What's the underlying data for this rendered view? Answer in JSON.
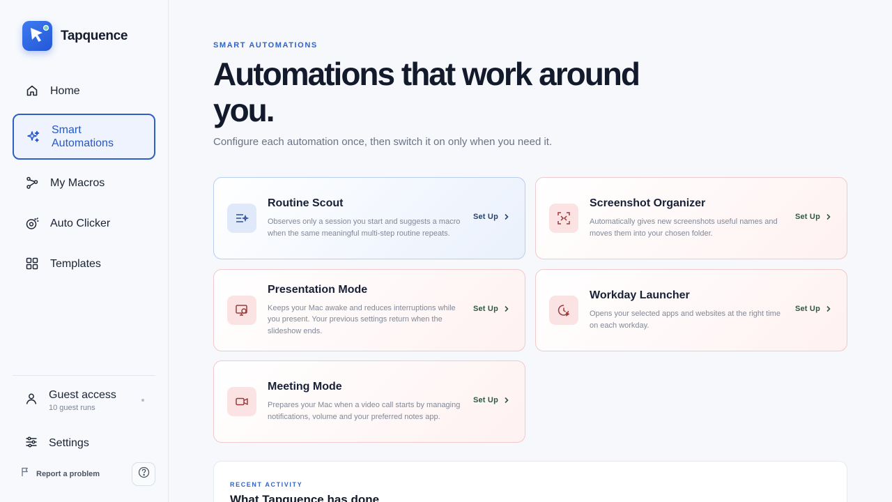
{
  "app": {
    "name": "Tapquence"
  },
  "sidebar": {
    "items": [
      {
        "label": "Home",
        "icon": "home-icon"
      },
      {
        "label": "Smart Automations",
        "icon": "sparkles-icon",
        "active": true
      },
      {
        "label": "My Macros",
        "icon": "macro-path-icon"
      },
      {
        "label": "Auto Clicker",
        "icon": "target-click-icon"
      },
      {
        "label": "Templates",
        "icon": "grid-icon"
      }
    ],
    "guest": {
      "title": "Guest access",
      "subtitle": "10 guest runs"
    },
    "settings_label": "Settings",
    "report_label": "Report a problem"
  },
  "header": {
    "eyebrow": "SMART AUTOMATIONS",
    "title": "Automations that work around you.",
    "subtitle": "Configure each automation once, then switch it on only when you need it."
  },
  "cards": [
    {
      "title": "Routine Scout",
      "description": "Observes only a session you start and suggests a macro when the same meaningful multi-step routine repeats.",
      "action": "Set Up",
      "icon": "routine-scan-icon"
    },
    {
      "title": "Screenshot Organizer",
      "description": "Automatically gives new screenshots useful names and moves them into your chosen folder.",
      "action": "Set Up",
      "icon": "screenshot-frame-icon"
    },
    {
      "title": "Presentation Mode",
      "description": "Keeps your Mac awake and reduces interruptions while you present. Your previous settings return when the slideshow ends.",
      "action": "Set Up",
      "icon": "presentation-monitor-icon"
    },
    {
      "title": "Workday Launcher",
      "description": "Opens your selected apps and websites at the right time on each workday.",
      "action": "Set Up",
      "icon": "clock-launch-icon"
    },
    {
      "title": "Meeting Mode",
      "description": "Prepares your Mac when a video call starts by managing notifications, volume and your preferred notes app.",
      "action": "Set Up",
      "icon": "video-camera-icon"
    }
  ],
  "recent": {
    "eyebrow": "RECENT ACTIVITY",
    "title": "What Tapquence has done"
  },
  "colors": {
    "accent": "#2557c9",
    "card_border_red": "#efc9cc",
    "card_border_blue": "#b9cdee",
    "action_green": "#2c5a41"
  }
}
